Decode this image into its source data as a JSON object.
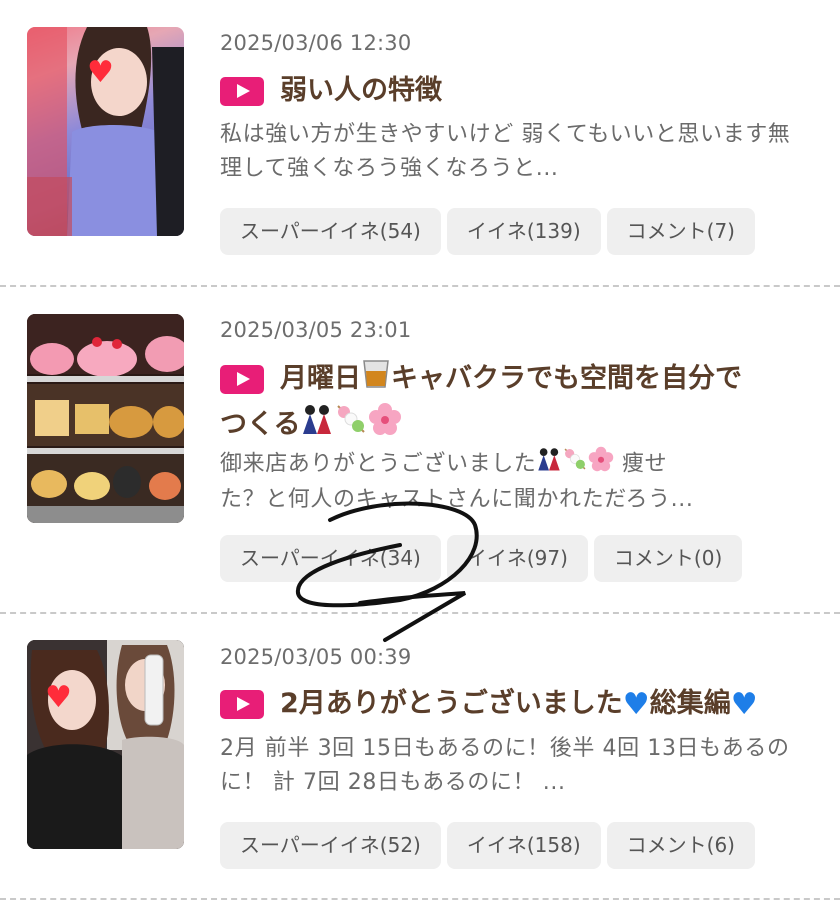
{
  "posts": [
    {
      "date": "2025/03/06 12:30",
      "title": "弱い人の特徴",
      "excerpt": "私は強い方が生きやすいけど 弱くてもいいと思います無理して強くなろう強くなろうと...",
      "buttons": {
        "super": "スーパーイイネ(54)",
        "like": "イイネ(139)",
        "comment": "コメント(7)"
      }
    },
    {
      "date": "2025/03/05 23:01",
      "title_part1": "月曜日",
      "title_part2": "キャバクラでも空間を自分で",
      "title_part3": "つくる",
      "excerpt_part1": "御来店ありがとうございました",
      "excerpt_part2": " 痩せ",
      "excerpt_part3": "た？と何人のキャストさんに聞かれただろう...",
      "buttons": {
        "super": "スーパーイイネ(34)",
        "like": "イイネ(97)",
        "comment": "コメント(0)"
      }
    },
    {
      "date": "2025/03/05 00:39",
      "title_part1": "2月ありがとうございました",
      "title_part2": "総集編",
      "excerpt": "2月 前半 3回 15日もあるのに！後半 4回 13日もあるのに！ 計 7回 28日もあるのに！ ...",
      "buttons": {
        "super": "スーパーイイネ(52)",
        "like": "イイネ(158)",
        "comment": "コメント(6)"
      }
    }
  ],
  "icons": {
    "play": "play-icon",
    "whisky": "whisky-glass-icon",
    "dolls": "hina-dolls-icon",
    "dango": "dango-icon",
    "blossom": "cherry-blossom-icon",
    "heart": "blue-heart-icon"
  },
  "colors": {
    "play_badge": "#e81e77",
    "title": "#5a3e2a",
    "button_bg": "#efefef"
  }
}
